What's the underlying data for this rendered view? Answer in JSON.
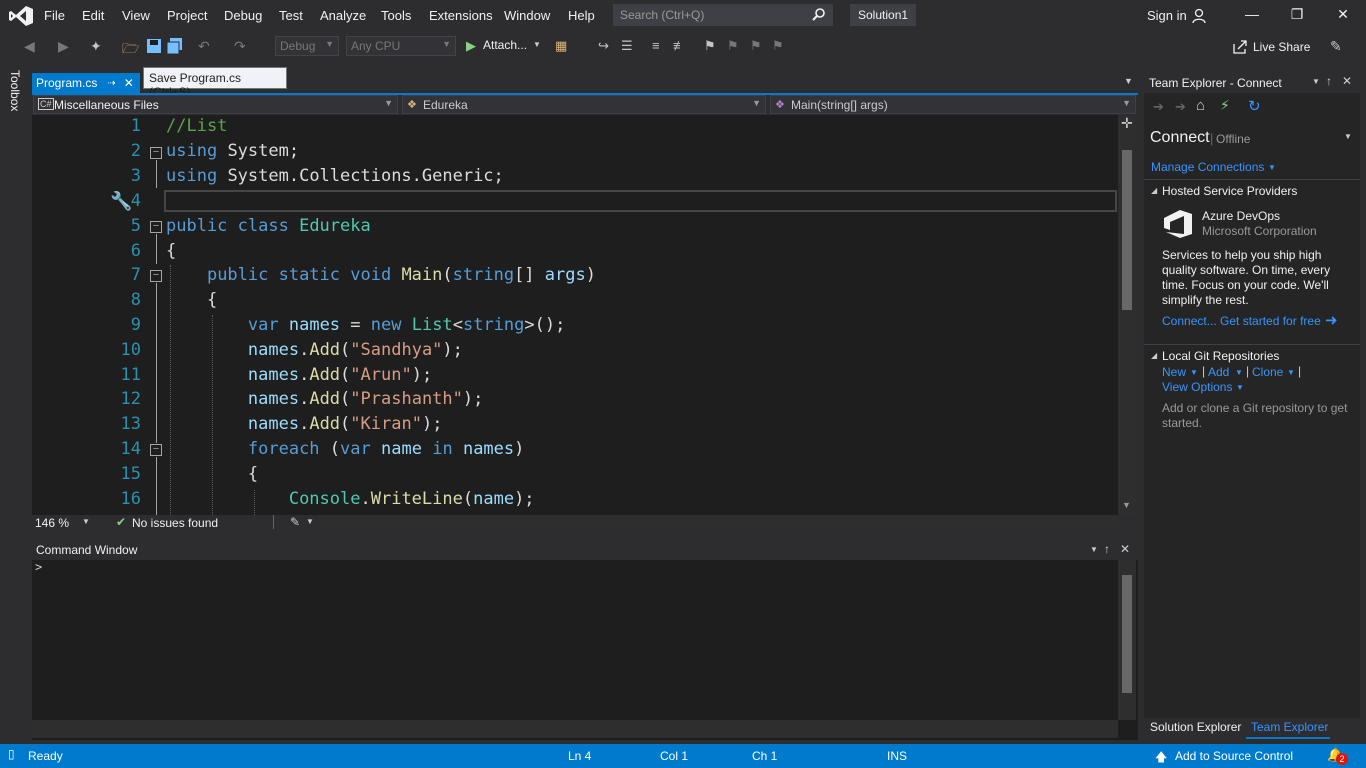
{
  "menu": {
    "items": [
      "File",
      "Edit",
      "View",
      "Project",
      "Debug",
      "Test",
      "Analyze",
      "Tools",
      "Extensions",
      "Window",
      "Help"
    ],
    "search_placeholder": "Search (Ctrl+Q)",
    "solution_title": "Solution1",
    "signin": "Sign in"
  },
  "toolbar": {
    "config": "Debug",
    "platform": "Any CPU",
    "attach": "Attach...",
    "liveshare": "Live Share"
  },
  "toolbox": {
    "label": "Toolbox"
  },
  "editor_tab": {
    "title": "Program.cs",
    "tooltip": "Save Program.cs (Ctrl+S)"
  },
  "navbar": {
    "project": "Miscellaneous Files",
    "type": "Edureka",
    "member": "Main(string[] args)"
  },
  "code": {
    "lines": [
      "1",
      "2",
      "3",
      "4",
      "5",
      "6",
      "7",
      "8",
      "9",
      "10",
      "11",
      "12",
      "13",
      "14",
      "15",
      "16"
    ]
  },
  "editor_status": {
    "zoom": "146 %",
    "issues": "No issues found"
  },
  "cmd_window": {
    "title": "Command Window",
    "prompt": ">"
  },
  "team_explorer": {
    "title": "Team Explorer - Connect",
    "connect": "Connect",
    "offline": "Offline",
    "manage": "Manage Connections",
    "hosted_header": "Hosted Service Providers",
    "azure_title": "Azure DevOps",
    "azure_company": "Microsoft Corporation",
    "azure_desc": "Services to help you ship high quality software. On time, every time. Focus on your code. We'll simplify the rest.",
    "azure_link": "Connect... Get started for free",
    "git_header": "Local Git Repositories",
    "git_new": "New",
    "git_add": "Add",
    "git_clone": "Clone",
    "view_options": "View Options",
    "git_desc": "Add or clone a Git repository to get started."
  },
  "bottom_tabs": {
    "solution": "Solution Explorer",
    "team": "Team Explorer"
  },
  "statusbar": {
    "ready": "Ready",
    "ln": "Ln 4",
    "col": "Col 1",
    "ch": "Ch 1",
    "ins": "INS",
    "source": "Add to Source Control",
    "notifications": "2"
  },
  "colors": {
    "accent": "#007acc",
    "editor_bg": "#1e1e1e",
    "chrome_bg": "#2d2d30"
  }
}
